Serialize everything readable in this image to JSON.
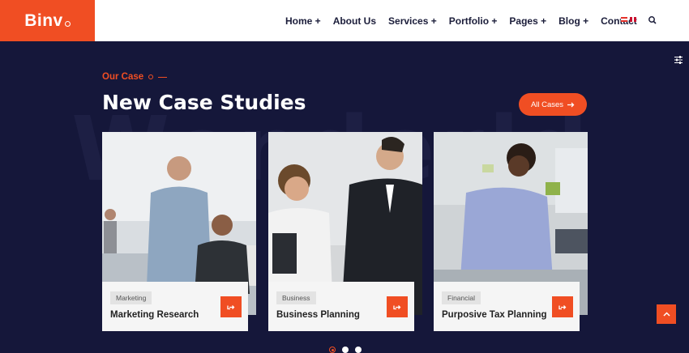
{
  "brand": {
    "logo_text": "Binv",
    "accent": "#f04e23",
    "background": "#15173a"
  },
  "nav": {
    "items": [
      "Home +",
      "About Us",
      "Services +",
      "Portfolio +",
      "Pages +",
      "Blog +",
      "Contact"
    ],
    "flags": [
      "flag-icon-1",
      "flag-icon-uk"
    ],
    "search_icon": "search-icon"
  },
  "section": {
    "eyebrow": "Our Case",
    "title": "New Case Studies",
    "button_label": "All Cases"
  },
  "cards": [
    {
      "tag": "Marketing",
      "title": "Marketing Research"
    },
    {
      "tag": "Business",
      "title": "Business Planning"
    },
    {
      "tag": "Financial",
      "title": "Purposive Tax Planning"
    }
  ],
  "carousel": {
    "total": 3,
    "active": 1
  }
}
